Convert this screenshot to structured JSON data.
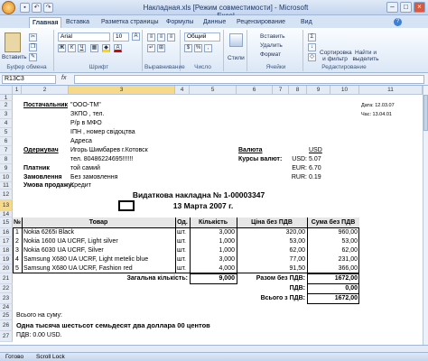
{
  "window": {
    "title": "Накладная.xls [Режим совместимости] - Microsoft Excel"
  },
  "tabs": [
    "Главная",
    "Вставка",
    "Разметка страницы",
    "Формулы",
    "Данные",
    "Рецензирование",
    "Вид"
  ],
  "ribbon": {
    "paste": "Вставить",
    "clipboard": "Буфер обмена",
    "font_name": "Arial",
    "font_size": "10",
    "font_group": "Шрифт",
    "bold": "Ж",
    "italic": "К",
    "underline": "Ч",
    "align_group": "Выравнивание",
    "number_format": "Общий",
    "number_group": "Число",
    "styles": "Стили",
    "insert": "Вставить",
    "delete": "Удалить",
    "format": "Формат",
    "cells_group": "Ячейки",
    "sort": "Сортировка и фильтр",
    "find": "Найти и выделить",
    "edit_group": "Редактирование"
  },
  "formula_bar": {
    "name_box": "R13C3",
    "fx": "fx"
  },
  "columns": [
    "1",
    "2",
    "3",
    "4",
    "5",
    "6",
    "7",
    "8",
    "9",
    "10",
    "11"
  ],
  "rows": [
    "1",
    "2",
    "3",
    "4",
    "5",
    "6",
    "7",
    "8",
    "9",
    "10",
    "11",
    "12",
    "13",
    "14",
    "15",
    "16",
    "17",
    "18",
    "19",
    "20",
    "21",
    "22",
    "23",
    "24",
    "25",
    "26",
    "27"
  ],
  "sheet": {
    "supplier_label": "Постачальник",
    "supplier": "\"ООО-ТМ\"",
    "okpo": "ЗКПО , тел.",
    "account": "Р/р  в    МФО",
    "ipn": "ІПН  , номер свідоцтва",
    "address": "Адреса",
    "date_label": "Дата: 12.03.07",
    "time_label": "Час: 13.04.01",
    "receiver_label": "Одержувач",
    "receiver": "Игорь Шимбарев г.Котовск",
    "receiver_phone": "тел. 80486224695!!!!!!",
    "currency_label": "Валюта",
    "currency": "USD",
    "rate_label": "Курсы валют:",
    "rate_usd_k": "USD:",
    "rate_usd": "5.07",
    "rate_eur_k": "EUR:",
    "rate_eur": "6.70",
    "rate_rur_k": "RUR:",
    "rate_rur": "0.19",
    "payer_label": "Платник",
    "payer": "той самий",
    "order_label": "Замовлення",
    "order": "Без замовлення",
    "terms_label": "Умова продажу:",
    "terms": "Кредит",
    "doc_title": "Видаткова накладна № 1-00003347",
    "doc_date": "13 Марта 2007 г.",
    "headers": [
      "№",
      "Товар",
      "Од.",
      "Кількість",
      "Ціна без ПДВ",
      "Сума без ПДВ"
    ],
    "items": [
      [
        "1",
        "Nokia 6265i Black",
        "шт.",
        "3,000",
        "320,00",
        "960,00"
      ],
      [
        "2",
        "Nokia 1600 UA UCRF, Light silver",
        "шт.",
        "1,000",
        "53,00",
        "53,00"
      ],
      [
        "3",
        "Nokia 6030 UA UCRF, Silver",
        "шт.",
        "1,000",
        "62,00",
        "62,00"
      ],
      [
        "4",
        "Samsung X680 UA UCRF, Light metelic blue",
        "шт.",
        "3,000",
        "77,00",
        "231,00"
      ],
      [
        "5",
        "Samsung X680 UA UCRF, Fashion red",
        "шт.",
        "4,000",
        "91,50",
        "366,00"
      ]
    ],
    "total_qty_label": "Загальна кількість:",
    "total_qty": "9,000",
    "sum_no_vat_label": "Разом без ПДВ:",
    "sum_no_vat": "1672,00",
    "vat_label": "ПДВ:",
    "vat": "0,00",
    "total_vat_label": "Всього з ПДВ:",
    "total_vat": "1672,00",
    "sum_words_label": "Всього на суму:",
    "sum_words": "Одна тысяча шестьсот семьдесят два доллара 00 центов",
    "vat_line": "ПДВ:            0.00 USD."
  },
  "status": {
    "ready": "Готово",
    "scroll": "Scroll Lock"
  }
}
